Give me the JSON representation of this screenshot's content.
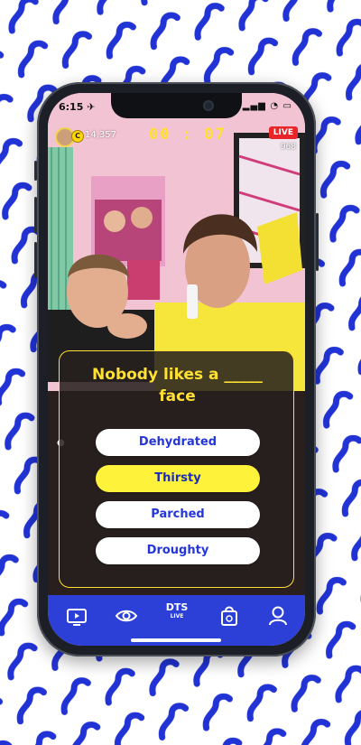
{
  "status_bar": {
    "time": "6:15 ✈",
    "icons": "▂▄▆ ◔ ▭"
  },
  "header": {
    "coins": "14,357",
    "timer": "00 : 07",
    "live_label": "LIVE",
    "viewers": "968"
  },
  "quiz": {
    "question": "Nobody likes a _____ face",
    "answers": [
      {
        "label": "Dehydrated",
        "selected": false
      },
      {
        "label": "Thirsty",
        "selected": true
      },
      {
        "label": "Parched",
        "selected": false
      },
      {
        "label": "Droughty",
        "selected": false
      }
    ]
  },
  "nav": {
    "items": [
      {
        "icon": "tv-icon"
      },
      {
        "icon": "eye-icon"
      },
      {
        "icon": "dts-live-logo",
        "label_top": "DTS",
        "label_bottom": "LIVE"
      },
      {
        "icon": "shopping-bag-icon"
      },
      {
        "icon": "profile-icon"
      }
    ]
  },
  "colors": {
    "brand_blue": "#2c3fd6",
    "accent_yellow": "#ffe033",
    "live_red": "#e8262a",
    "pattern_blue": "#2233d6"
  }
}
